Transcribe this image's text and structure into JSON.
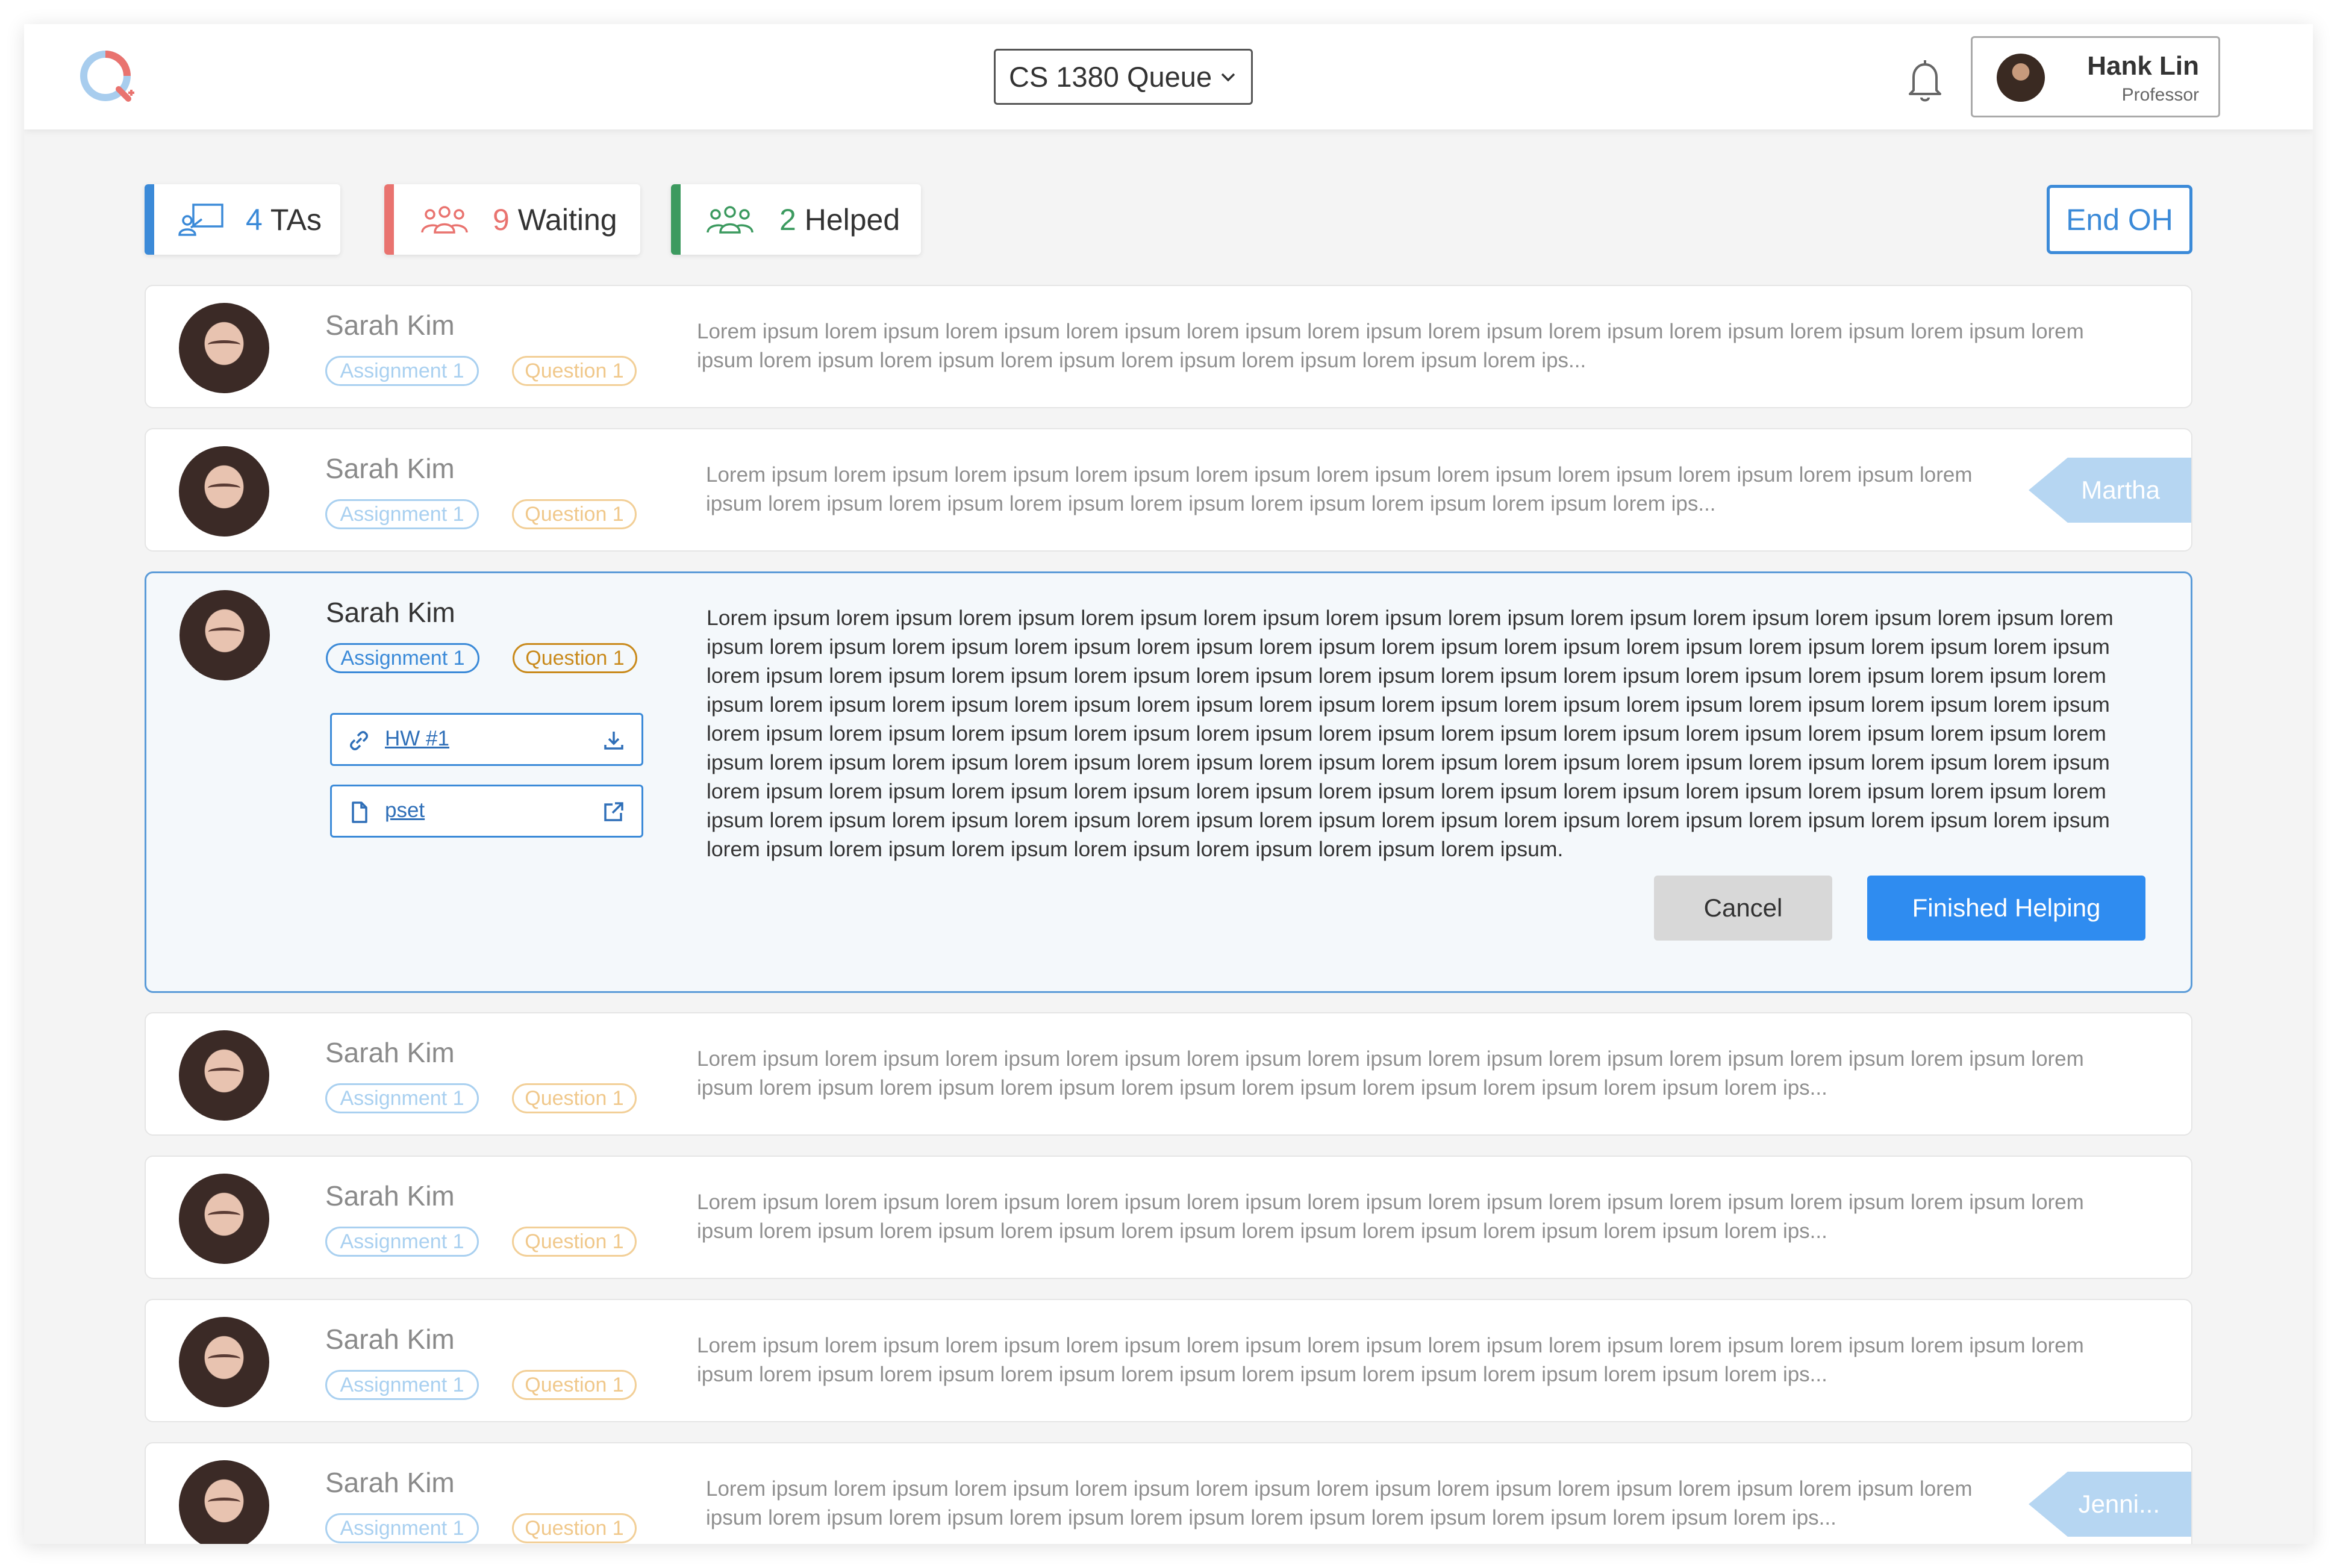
{
  "header": {
    "queue_label": "CS 1380 Queue",
    "user": {
      "name": "Hank Lin",
      "role": "Professor"
    }
  },
  "stats": {
    "tas": {
      "count": "4",
      "label": "TAs",
      "color": "#3b8ad8"
    },
    "waiting": {
      "count": "9",
      "label": "Waiting",
      "color": "#e9736f"
    },
    "helped": {
      "count": "2",
      "label": "Helped",
      "color": "#3c9a5f"
    }
  },
  "actions": {
    "end_oh": "End OH",
    "cancel": "Cancel",
    "finished": "Finished Helping"
  },
  "rows": [
    {
      "name": "Sarah Kim",
      "assignment": "Assignment 1",
      "question": "Question 1",
      "text": "Lorem ipsum lorem ipsum lorem ipsum lorem ipsum lorem ipsum lorem ipsum lorem ipsum lorem ipsum lorem ipsum lorem ipsum lorem ipsum lorem ipsum lorem ipsum lorem ipsum lorem ipsum lorem ipsum lorem ipsum lorem ipsum lorem ips..."
    },
    {
      "name": "Sarah Kim",
      "assignment": "Assignment 1",
      "question": "Question 1",
      "text": "Lorem ipsum lorem ipsum lorem ipsum lorem ipsum lorem ipsum lorem ipsum lorem ipsum lorem ipsum lorem ipsum lorem ipsum lorem ipsum lorem ipsum lorem ipsum lorem ipsum lorem ipsum lorem ipsum lorem ipsum lorem ipsum lorem ips...",
      "ta": "Martha"
    },
    {
      "name": "Sarah Kim",
      "assignment": "Assignment 1",
      "question": "Question 1",
      "text": "Lorem ipsum lorem ipsum lorem ipsum lorem ipsum lorem ipsum lorem ipsum lorem ipsum lorem ipsum lorem ipsum lorem ipsum lorem ipsum lorem ipsum lorem ipsum lorem ipsum lorem ipsum lorem ipsum lorem ipsum lorem ipsum lorem ipsum lorem ipsum lorem ipsum lorem ipsum lorem ipsum lorem ipsum lorem ipsum lorem ipsum lorem ipsum lorem ipsum lorem ipsum lorem ipsum lorem ipsum lorem ipsum lorem ipsum lorem ipsum lorem ipsum lorem ipsum lorem ipsum lorem ipsum lorem ipsum lorem ipsum lorem ipsum lorem ipsum lorem ipsum lorem ipsum lorem ipsum lorem ipsum lorem ipsum lorem ipsum lorem ipsum lorem ipsum lorem ipsum lorem ipsum lorem ipsum lorem ipsum lorem ipsum lorem ipsum lorem ipsum lorem ipsum lorem ipsum lorem ipsum lorem ipsum lorem ipsum lorem ipsum lorem ipsum lorem ipsum lorem ipsum lorem ipsum lorem ipsum lorem ipsum lorem ipsum lorem ipsum lorem ipsum lorem ipsum lorem ipsum lorem ipsum lorem ipsum lorem ipsum lorem ipsum lorem ipsum lorem ipsum lorem ipsum lorem ipsum lorem ipsum lorem ipsum lorem ipsum lorem ipsum lorem ipsum lorem ipsum lorem ipsum lorem ipsum lorem ipsum lorem ipsum lorem ipsum lorem ipsum lorem ipsum lorem ipsum lorem ipsum lorem ipsum lorem ipsum.",
      "attachments": [
        {
          "label": "HW #1",
          "icon": "link-icon",
          "action": "download-icon"
        },
        {
          "label": "pset",
          "icon": "file-icon",
          "action": "external-link-icon"
        }
      ]
    },
    {
      "name": "Sarah Kim",
      "assignment": "Assignment 1",
      "question": "Question 1",
      "text": "Lorem ipsum lorem ipsum lorem ipsum lorem ipsum lorem ipsum lorem ipsum lorem ipsum lorem ipsum lorem ipsum lorem ipsum lorem ipsum lorem ipsum lorem ipsum lorem ipsum lorem ipsum lorem ipsum lorem ipsum lorem ipsum lorem ipsum lorem ipsum lorem ips..."
    },
    {
      "name": "Sarah Kim",
      "assignment": "Assignment 1",
      "question": "Question 1",
      "text": "Lorem ipsum lorem ipsum lorem ipsum lorem ipsum lorem ipsum lorem ipsum lorem ipsum lorem ipsum lorem ipsum lorem ipsum lorem ipsum lorem ipsum lorem ipsum lorem ipsum lorem ipsum lorem ipsum lorem ipsum lorem ipsum lorem ipsum lorem ipsum lorem ips..."
    },
    {
      "name": "Sarah Kim",
      "assignment": "Assignment 1",
      "question": "Question 1",
      "text": "Lorem ipsum lorem ipsum lorem ipsum lorem ipsum lorem ipsum lorem ipsum lorem ipsum lorem ipsum lorem ipsum lorem ipsum lorem ipsum lorem ipsum lorem ipsum lorem ipsum lorem ipsum lorem ipsum lorem ipsum lorem ipsum lorem ipsum lorem ipsum lorem ips..."
    },
    {
      "name": "Sarah Kim",
      "assignment": "Assignment 1",
      "question": "Question 1",
      "text": "Lorem ipsum lorem ipsum lorem ipsum lorem ipsum lorem ipsum lorem ipsum lorem ipsum lorem ipsum lorem ipsum lorem ipsum lorem ipsum lorem ipsum lorem ipsum lorem ipsum lorem ipsum lorem ipsum lorem ipsum lorem ipsum lorem ipsum lorem ips...",
      "ta": "Jenni..."
    }
  ]
}
